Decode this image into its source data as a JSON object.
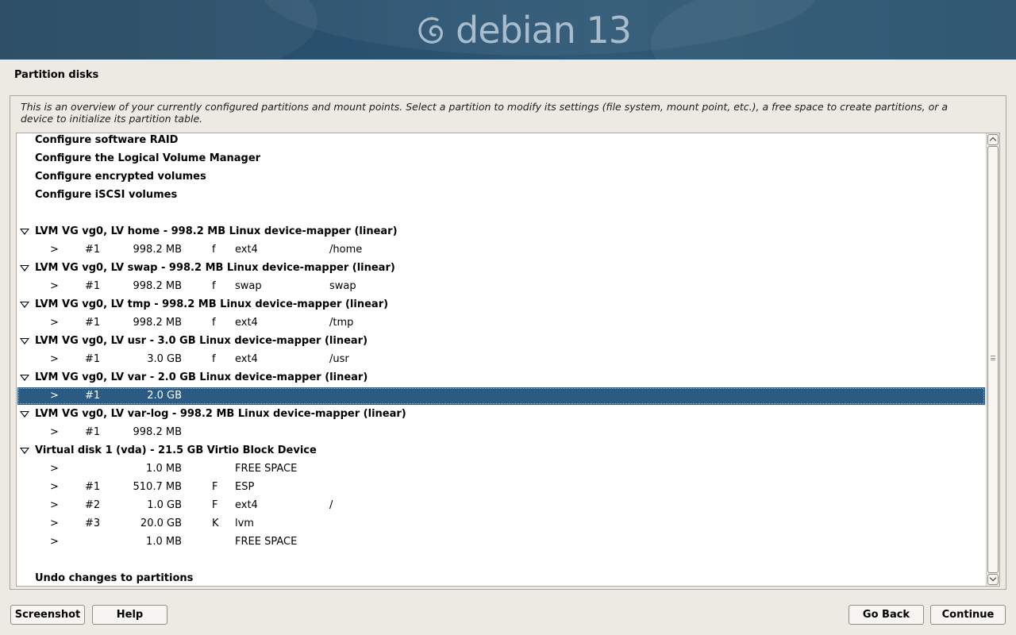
{
  "banner": {
    "brand_text": "debian 13"
  },
  "page_title": "Partition disks",
  "description": "This is an overview of your currently configured partitions and mount points. Select a partition to modify its settings (file system, mount point, etc.), a free space to create partitions, or a device to initialize its partition table.",
  "menu": {
    "raid": "Configure software RAID",
    "lvm": "Configure the Logical Volume Manager",
    "encrypted": "Configure encrypted volumes",
    "iscsi": "Configure iSCSI volumes"
  },
  "devices": [
    {
      "label": "LVM VG vg0, LV home - 998.2 MB Linux device-mapper (linear)",
      "partitions": [
        {
          "arrow": ">",
          "num": "#1",
          "size": "998.2 MB",
          "flag": "f",
          "fs": "ext4",
          "mount": "/home"
        }
      ]
    },
    {
      "label": "LVM VG vg0, LV swap - 998.2 MB Linux device-mapper (linear)",
      "partitions": [
        {
          "arrow": ">",
          "num": "#1",
          "size": "998.2 MB",
          "flag": "f",
          "fs": "swap",
          "mount": "swap"
        }
      ]
    },
    {
      "label": "LVM VG vg0, LV tmp - 998.2 MB Linux device-mapper (linear)",
      "partitions": [
        {
          "arrow": ">",
          "num": "#1",
          "size": "998.2 MB",
          "flag": "f",
          "fs": "ext4",
          "mount": "/tmp"
        }
      ]
    },
    {
      "label": "LVM VG vg0, LV usr - 3.0 GB Linux device-mapper (linear)",
      "partitions": [
        {
          "arrow": ">",
          "num": "#1",
          "size": "3.0 GB",
          "flag": "f",
          "fs": "ext4",
          "mount": "/usr"
        }
      ]
    },
    {
      "label": "LVM VG vg0, LV var - 2.0 GB Linux device-mapper (linear)",
      "partitions": [
        {
          "arrow": ">",
          "num": "#1",
          "size": "2.0 GB",
          "flag": "",
          "fs": "",
          "mount": "",
          "selected": true
        }
      ]
    },
    {
      "label": "LVM VG vg0, LV var-log - 998.2 MB Linux device-mapper (linear)",
      "partitions": [
        {
          "arrow": ">",
          "num": "#1",
          "size": "998.2 MB",
          "flag": "",
          "fs": "",
          "mount": ""
        }
      ]
    },
    {
      "label": "Virtual disk 1 (vda) - 21.5 GB Virtio Block Device",
      "partitions": [
        {
          "arrow": ">",
          "num": "",
          "size": "1.0 MB",
          "flag": "",
          "fs": "FREE SPACE",
          "mount": ""
        },
        {
          "arrow": ">",
          "num": "#1",
          "size": "510.7 MB",
          "flag": "F",
          "fs": "ESP",
          "mount": ""
        },
        {
          "arrow": ">",
          "num": "#2",
          "size": "1.0 GB",
          "flag": "F",
          "fs": "ext4",
          "mount": "/"
        },
        {
          "arrow": ">",
          "num": "#3",
          "size": "20.0 GB",
          "flag": "K",
          "fs": "lvm",
          "mount": ""
        },
        {
          "arrow": ">",
          "num": "",
          "size": "1.0 MB",
          "flag": "",
          "fs": "FREE SPACE",
          "mount": ""
        }
      ]
    }
  ],
  "undo": "Undo changes to partitions",
  "buttons": {
    "screenshot": "Screenshot",
    "help": "Help",
    "go_back": "Go Back",
    "continue": "Continue"
  },
  "colors": {
    "banner": "#2a5270",
    "selection": "#2b5b82",
    "background": "#edeae3"
  }
}
